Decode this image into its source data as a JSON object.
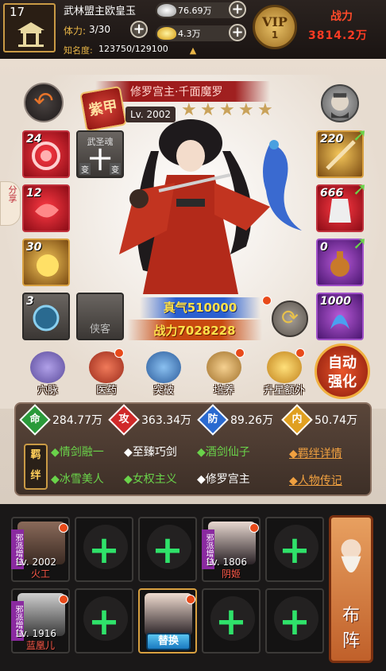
{
  "header": {
    "level": "17",
    "player_name": "武林盟主欧皇玉",
    "stamina_label": "体力:",
    "stamina_value": "3/30",
    "fame_label": "知名度:",
    "fame_value": "123750/129100",
    "silver": "76.69万",
    "gold": "4.3万",
    "vip_label": "VIP",
    "vip_level": "1",
    "power_label": "战力",
    "power_value": "3814.2万"
  },
  "hero": {
    "title": "修罗宫主·千面魔罗",
    "seal": "紫甲",
    "level": "Lv. 2002",
    "stars": 5,
    "qi": "真气510000",
    "combat": "战力7028228",
    "side_tab": "分享"
  },
  "equipment": {
    "left": [
      {
        "count": "24",
        "color": "red",
        "icon": "spiral-gem-icon"
      },
      {
        "count": "12",
        "color": "red",
        "icon": "red-gem-icon"
      },
      {
        "count": "30",
        "color": "gold",
        "icon": "gold-gem-icon"
      },
      {
        "count": "3",
        "color": "grey",
        "icon": "blue-orb-icon"
      }
    ],
    "soul_label": "武圣魂",
    "soul_left": "变",
    "soul_right": "变",
    "companion_label": "侠客",
    "right": [
      {
        "count": "220",
        "color": "gold",
        "icon": "sword-icon"
      },
      {
        "count": "666",
        "color": "red",
        "icon": "armor-icon"
      },
      {
        "count": "0",
        "color": "purple",
        "icon": "teapot-icon"
      },
      {
        "count": "1000",
        "color": "purple",
        "icon": "phoenix-icon"
      }
    ]
  },
  "actions": [
    {
      "label": "穴脉",
      "icon": "meridian-icon"
    },
    {
      "label": "医药",
      "icon": "medicine-icon"
    },
    {
      "label": "突破",
      "icon": "breakthrough-icon"
    },
    {
      "label": "培养",
      "icon": "scroll-icon"
    },
    {
      "label": "升星额外",
      "icon": "treasure-icon"
    }
  ],
  "auto_button": "自动强化",
  "stats": {
    "hp_label": "命",
    "hp": "284.77万",
    "atk_label": "攻",
    "atk": "363.34万",
    "def_label": "防",
    "def": "89.26万",
    "int_label": "内",
    "int": "50.74万"
  },
  "bonds": {
    "label1": "羁",
    "label2": "绊",
    "row1": [
      {
        "text": "情剑融一",
        "active": true
      },
      {
        "text": "至臻巧剑",
        "active": false
      },
      {
        "text": "酒剑仙子",
        "active": true
      }
    ],
    "row2": [
      {
        "text": "冰雪美人",
        "active": true
      },
      {
        "text": "女权主义",
        "active": true
      },
      {
        "text": "修罗宫主",
        "active": false
      }
    ],
    "link1": "羁绊详情",
    "link2": "人物传记"
  },
  "team": [
    {
      "type": "hero",
      "level": "Lv. 2002",
      "name": "火工",
      "tag": "邪派增益"
    },
    {
      "type": "empty"
    },
    {
      "type": "empty"
    },
    {
      "type": "hero",
      "level": "Lv. 1806",
      "name": "阴姬",
      "tag": "邪派增益"
    },
    {
      "type": "empty"
    },
    {
      "type": "hero",
      "level": "Lv. 1916",
      "name": "蓝凰儿",
      "tag": "邪派增益"
    },
    {
      "type": "empty"
    },
    {
      "type": "current",
      "swap": "替换"
    },
    {
      "type": "empty"
    },
    {
      "type": "empty"
    }
  ],
  "formation": "布阵",
  "colors": {
    "green": "#6ad34a",
    "gold": "#e8b547",
    "red_accent": "#ff3b23"
  }
}
